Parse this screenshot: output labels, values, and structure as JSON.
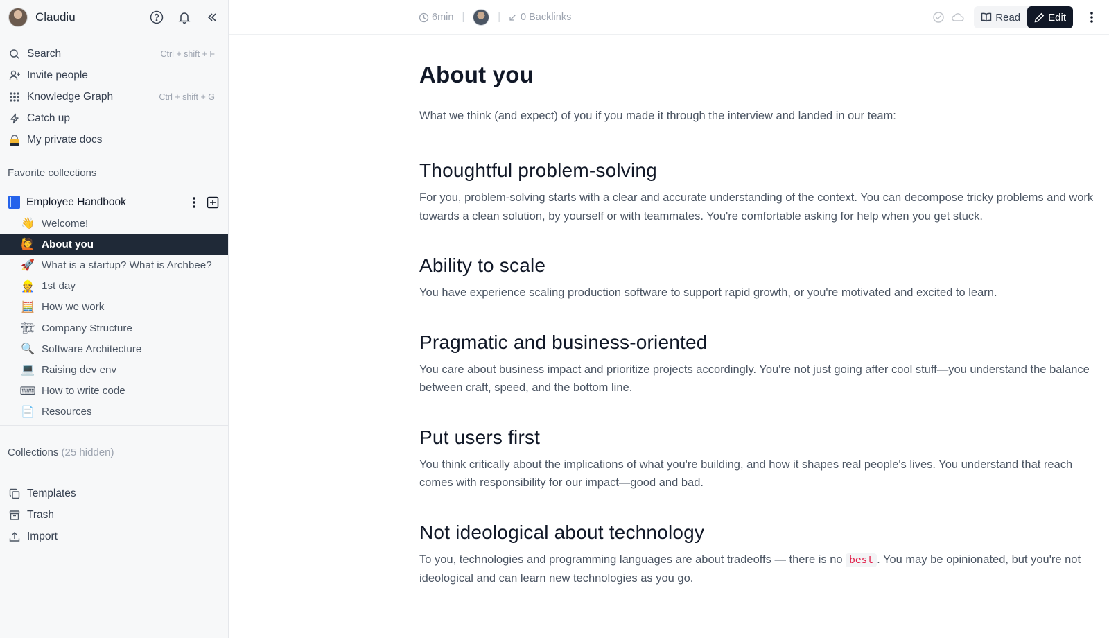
{
  "sidebar": {
    "user_name": "Claudiu",
    "nav": [
      {
        "label": "Search",
        "shortcut": "Ctrl + shift + F",
        "icon": "search-icon"
      },
      {
        "label": "Invite people",
        "shortcut": "",
        "icon": "invite-user-icon"
      },
      {
        "label": "Knowledge Graph",
        "shortcut": "Ctrl + shift + G",
        "icon": "graph-icon"
      },
      {
        "label": "Catch up",
        "shortcut": "",
        "icon": "lightning-icon"
      },
      {
        "label": "My private docs",
        "shortcut": "",
        "icon": "lock-icon"
      }
    ],
    "favorites_title": "Favorite collections",
    "collection": {
      "name": "Employee Handbook",
      "docs": [
        {
          "label": "Welcome!",
          "emoji": "👋"
        },
        {
          "label": "About you",
          "emoji": "🙋"
        },
        {
          "label": "What is a startup? What is Archbee?",
          "emoji": "🚀"
        },
        {
          "label": "1st day",
          "emoji": "👷"
        },
        {
          "label": "How we work",
          "emoji": "🧮"
        },
        {
          "label": "Company Structure",
          "emoji": "🏗"
        },
        {
          "label": "Software Architecture",
          "emoji": "🔍"
        },
        {
          "label": "Raising dev env",
          "emoji": "💻"
        },
        {
          "label": "How to write code",
          "emoji": "⌨"
        },
        {
          "label": "Resources",
          "emoji": "📄"
        }
      ],
      "active_index": 1
    },
    "collections_title": "Collections",
    "collections_hidden": "(25 hidden)",
    "bottom_nav": [
      {
        "label": "Templates",
        "icon": "copy-icon"
      },
      {
        "label": "Trash",
        "icon": "archive-icon"
      },
      {
        "label": "Import",
        "icon": "upload-icon"
      }
    ]
  },
  "topbar": {
    "read_time": "6min",
    "backlinks": "0 Backlinks",
    "read_label": "Read",
    "edit_label": "Edit"
  },
  "document": {
    "title": "About you",
    "intro": "What we think (and expect) of you if you made it through the interview and landed in our team:",
    "sections": [
      {
        "heading": "Thoughtful problem-solving",
        "body": "For you, problem-solving starts with a clear and accurate understanding of the context. You can decompose tricky problems and work towards a clean solution, by yourself or with teammates. You're comfortable asking for help when you get stuck."
      },
      {
        "heading": "Ability to scale",
        "body": "You have experience scaling production software to support rapid growth, or you're motivated and excited to learn."
      },
      {
        "heading": "Pragmatic and business-oriented",
        "body": "You care about business impact and prioritize projects accordingly. You're not just going after cool stuff—you understand the balance between craft, speed, and the bottom line."
      },
      {
        "heading": "Put users first",
        "body": "You think critically about the implications of what you're building, and how it shapes real people's lives. You understand that reach comes with responsibility for our impact—good and bad."
      },
      {
        "heading": "Not ideological about technology",
        "body_before": "To you, technologies and programming languages are about tradeoffs — there is no ",
        "body_code": "best",
        "body_after": ". You may be opinionated, but you're not ideological and can learn new technologies as you go."
      }
    ]
  },
  "colors": {
    "sidebar_bg": "#f7f8f9",
    "active_item_bg": "#1f2937",
    "edit_button_bg": "#111827",
    "code_text": "#e11d48"
  }
}
